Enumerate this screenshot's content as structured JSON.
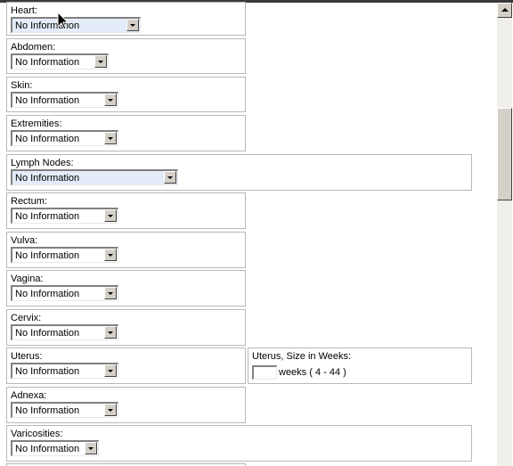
{
  "fields": [
    {
      "key": "heart",
      "label": "Heart:",
      "value": "No Information"
    },
    {
      "key": "abdomen",
      "label": "Abdomen:",
      "value": "No Information"
    },
    {
      "key": "skin",
      "label": "Skin:",
      "value": "No Information"
    },
    {
      "key": "extremities",
      "label": "Extremities:",
      "value": "No Information"
    },
    {
      "key": "lymph_nodes",
      "label": "Lymph Nodes:",
      "value": "No Information"
    },
    {
      "key": "rectum",
      "label": "Rectum:",
      "value": "No Information"
    },
    {
      "key": "vulva",
      "label": "Vulva:",
      "value": "No Information"
    },
    {
      "key": "vagina",
      "label": "Vagina:",
      "value": "No Information"
    },
    {
      "key": "cervix",
      "label": "Cervix:",
      "value": "No Information"
    },
    {
      "key": "uterus",
      "label": "Uterus:",
      "value": "No Information"
    },
    {
      "key": "adnexa",
      "label": "Adnexa:",
      "value": "No Information"
    },
    {
      "key": "varicosities",
      "label": "Varicosities:",
      "value": "No Information"
    }
  ],
  "uterus_size": {
    "label": "Uterus, Size in Weeks:",
    "value": "",
    "hint": "weeks ( 4 - 44 )"
  },
  "icons": {
    "cursor": "mouse-pointer-icon",
    "dropdown": "chevron-down-icon",
    "scroll_up": "scroll-up-arrow-icon"
  }
}
